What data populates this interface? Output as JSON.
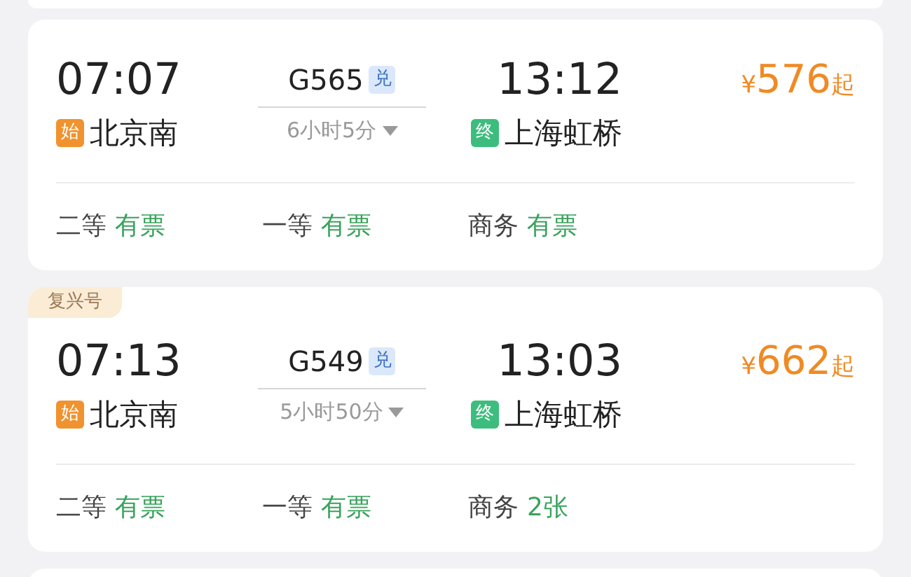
{
  "trains": [
    {
      "dep_time": "07:07",
      "dep_badge": "始",
      "dep_station": "北京南",
      "train_no": "G565",
      "exchange_badge": "兑",
      "duration": "6小时5分",
      "arr_time": "13:12",
      "arr_badge": "终",
      "arr_station": "上海虹桥",
      "currency": "¥",
      "price": "576",
      "price_suffix": "起",
      "seats": [
        {
          "class": "二等",
          "availability": "有票"
        },
        {
          "class": "一等",
          "availability": "有票"
        },
        {
          "class": "商务",
          "availability": "有票"
        }
      ]
    },
    {
      "tag": "复兴号",
      "dep_time": "07:13",
      "dep_badge": "始",
      "dep_station": "北京南",
      "train_no": "G549",
      "exchange_badge": "兑",
      "duration": "5小时50分",
      "arr_time": "13:03",
      "arr_badge": "终",
      "arr_station": "上海虹桥",
      "currency": "¥",
      "price": "662",
      "price_suffix": "起",
      "seats": [
        {
          "class": "二等",
          "availability": "有票"
        },
        {
          "class": "一等",
          "availability": "有票"
        },
        {
          "class": "商务",
          "availability": "2张"
        }
      ]
    }
  ]
}
